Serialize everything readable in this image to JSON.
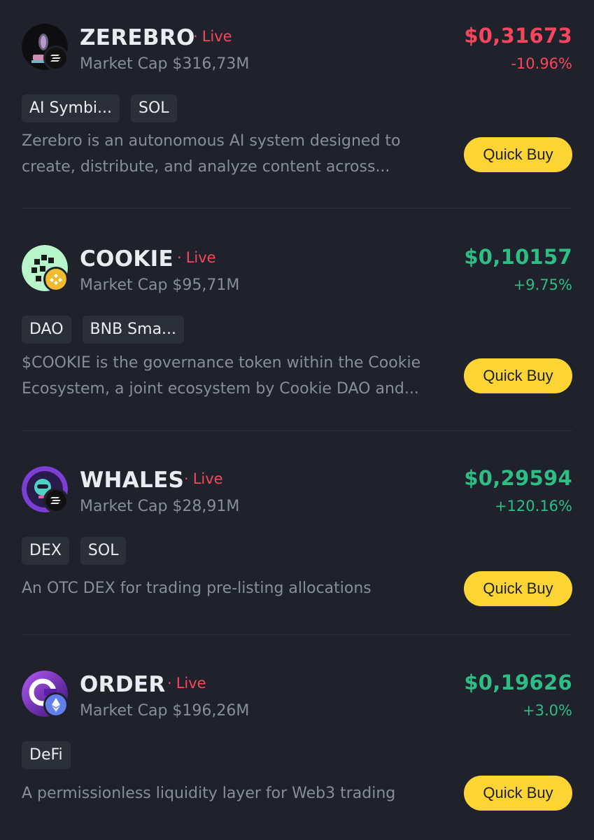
{
  "colors": {
    "background": "#1f222b",
    "negative": "#f6465d",
    "positive": "#2ebd85",
    "button": "#fcd535",
    "tag_bg": "#2b2f38"
  },
  "tokens": [
    {
      "name": "ZEREBRO",
      "status": "Live",
      "market_cap": "Market Cap $316,73M",
      "price": "$0,31673",
      "change": "-10.96%",
      "trend": "negative",
      "tags": [
        "AI Symbi...",
        "SOL"
      ],
      "description": "Zerebro is an autonomous AI system designed to create, distribute, and analyze content across...",
      "button": "Quick Buy",
      "logo_icon": "zerebro-logo-icon",
      "chain_icon": "solana-icon"
    },
    {
      "name": "COOKIE",
      "status": "Live",
      "market_cap": "Market Cap $95,71M",
      "price": "$0,10157",
      "change": "+9.75%",
      "trend": "positive",
      "tags": [
        "DAO",
        "BNB Sma..."
      ],
      "description": "$COOKIE is the governance token within the Cookie Ecosystem, a joint ecosystem by Cookie DAO and...",
      "button": "Quick Buy",
      "logo_icon": "cookie-logo-icon",
      "chain_icon": "bnb-icon"
    },
    {
      "name": "WHALES",
      "status": "Live",
      "market_cap": "Market Cap $28,91M",
      "price": "$0,29594",
      "change": "+120.16%",
      "trend": "positive",
      "tags": [
        "DEX",
        "SOL"
      ],
      "description": "An OTC DEX for trading pre-listing allocations",
      "button": "Quick Buy",
      "logo_icon": "whales-logo-icon",
      "chain_icon": "solana-icon"
    },
    {
      "name": "ORDER",
      "status": "Live",
      "market_cap": "Market Cap $196,26M",
      "price": "$0,19626",
      "change": "+3.0%",
      "trend": "positive",
      "tags": [
        "DeFi"
      ],
      "description": "A permissionless liquidity layer for Web3 trading",
      "button": "Quick Buy",
      "logo_icon": "order-logo-icon",
      "chain_icon": "ethereum-icon"
    }
  ]
}
